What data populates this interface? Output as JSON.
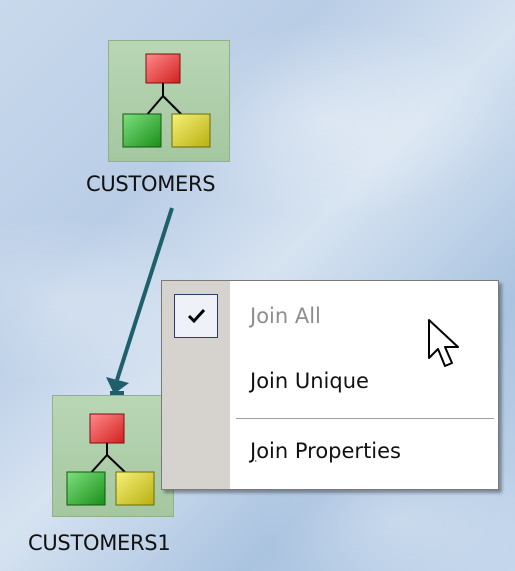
{
  "nodes": [
    {
      "label": "CUSTOMERS"
    },
    {
      "label": "CUSTOMERS1"
    }
  ],
  "context_menu": {
    "items": [
      {
        "label": "Join All",
        "checked": true,
        "enabled": false
      },
      {
        "label": "Join Unique",
        "checked": false,
        "enabled": true
      },
      {
        "label_accel": "J",
        "label_rest": "oin Properties",
        "checked": false,
        "enabled": true
      }
    ]
  },
  "colors": {
    "link": "#1f5f6a",
    "node_bg": "#a4c7a0",
    "top_block": "#e23a3a",
    "left_block": "#2fa62f",
    "right_block": "#d8d21e"
  },
  "icons": [
    "hierarchy-icon",
    "checkmark-icon",
    "arrow-cursor-icon"
  ]
}
